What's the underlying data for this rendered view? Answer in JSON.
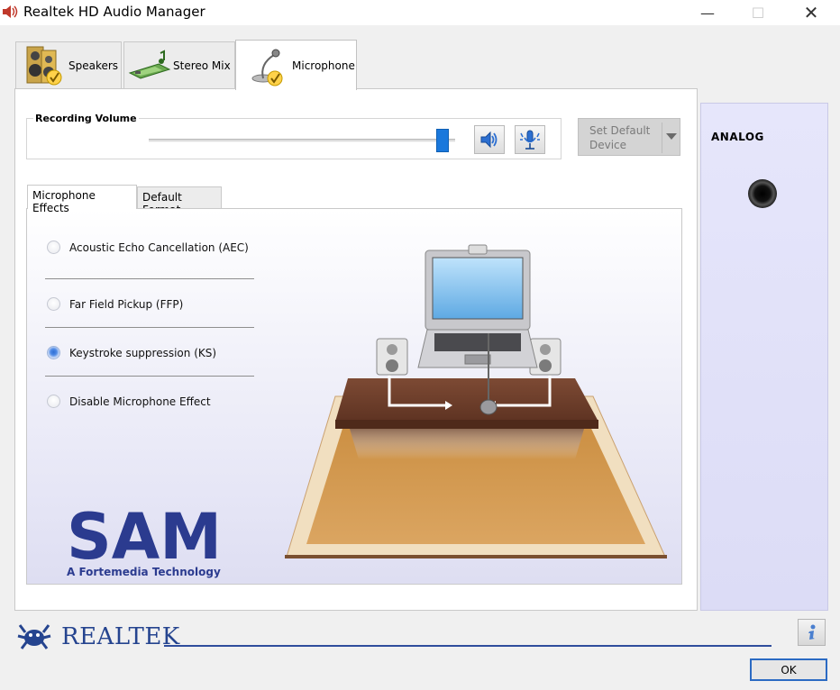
{
  "window": {
    "title": "Realtek HD Audio Manager",
    "minimize": "—",
    "maximize": "☐",
    "close": "✕"
  },
  "device_tabs": [
    {
      "label": "Speakers",
      "icon": "speakers-icon",
      "active": false
    },
    {
      "label": "Stereo Mix",
      "icon": "stereo-mix-icon",
      "active": false
    },
    {
      "label": "Microphone",
      "icon": "microphone-icon",
      "active": true
    }
  ],
  "recording": {
    "title": "Recording Volume",
    "volume_level": 0.98,
    "mute_icon": "speaker-volume-icon",
    "mic_boost_icon": "microphone-boost-icon"
  },
  "set_default": {
    "label": "Set Default Device",
    "enabled": false
  },
  "effects_tabs": [
    {
      "label": "Microphone Effects",
      "active": true
    },
    {
      "label": "Default Format",
      "active": false
    }
  ],
  "effects": [
    {
      "label": "Acoustic Echo Cancellation (AEC)",
      "checked": false
    },
    {
      "label": "Far Field Pickup (FFP)",
      "checked": false
    },
    {
      "label": "Keystroke suppression (KS)",
      "checked": true
    },
    {
      "label": "Disable Microphone Effect",
      "checked": false
    }
  ],
  "sam": {
    "logo": "SAM",
    "subtitle": "A Fortemedia Technology"
  },
  "analog": {
    "title": "ANALOG",
    "jack_icon": "audio-jack-icon"
  },
  "footer": {
    "brand": "REALTEK",
    "info_icon": "info-icon",
    "ok_label": "OK"
  },
  "colors": {
    "accent": "#1a78dc",
    "brand": "#25448f",
    "analog_panel": "#e2e2f8"
  }
}
